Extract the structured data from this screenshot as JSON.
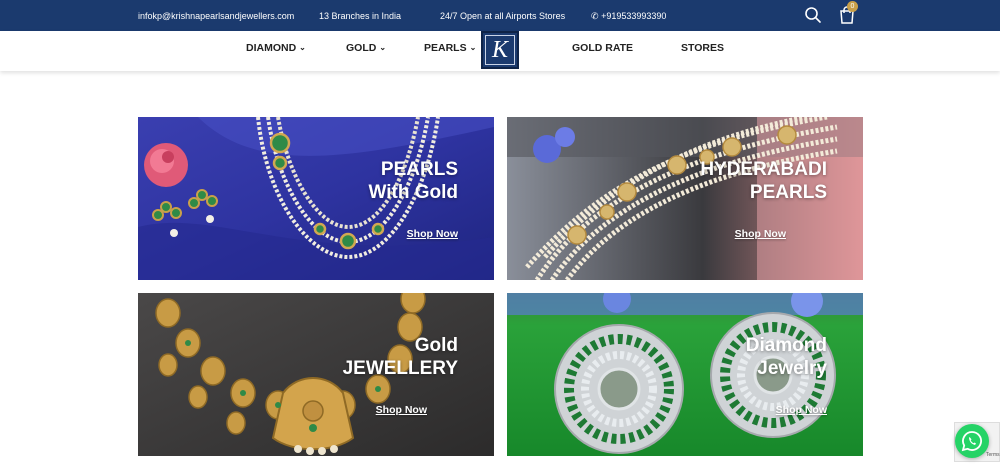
{
  "topbar": {
    "email": "infokp@krishnapearlsandjewellers.com",
    "branches": "13 Branches in India",
    "airport": "24/7 Open at all Airports Stores",
    "phone": "+919533993390",
    "cart_count": "0",
    "bg_color": "#1b3a6e"
  },
  "nav": {
    "items": [
      {
        "label": "DIAMOND"
      },
      {
        "label": "GOLD"
      },
      {
        "label": "PEARLS"
      },
      {
        "label": "GOLD RATE"
      },
      {
        "label": "STORES"
      }
    ],
    "logo_letter": "K"
  },
  "tiles": [
    {
      "line1": "PEARLS",
      "line2": "With Gold",
      "cta": "Shop Now"
    },
    {
      "line1": "HYDERABADI",
      "line2": "PEARLS",
      "cta": "Shop Now"
    },
    {
      "line1": "Gold",
      "line2": "JEWELLERY",
      "cta": "Shop Now"
    },
    {
      "line1": "Diamond",
      "line2": "Jewelry",
      "cta": "Shop Now"
    }
  ],
  "recaptcha": {
    "text": "Terms"
  },
  "icons": [
    "search-icon",
    "cart-icon",
    "phone-icon",
    "whatsapp-icon",
    "chevron-down-icon"
  ]
}
